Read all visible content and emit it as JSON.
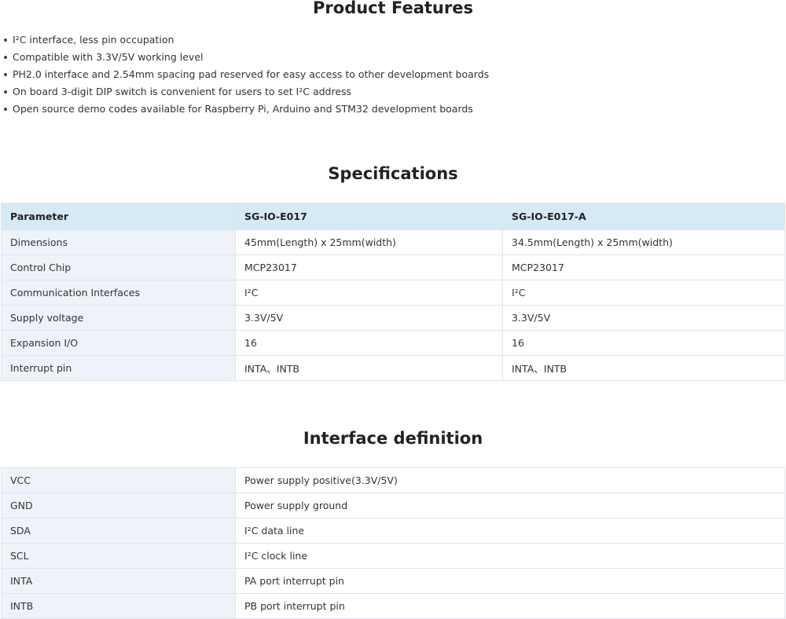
{
  "features": {
    "title": "Product Features",
    "items": [
      "I²C interface, less pin occupation",
      "Compatible with 3.3V/5V working level",
      "PH2.0 interface and 2.54mm spacing pad reserved for easy access to other development boards",
      "On board 3-digit DIP switch is convenient for users to set I²C address",
      "Open source demo codes available for Raspberry Pi, Arduino and STM32 development boards"
    ]
  },
  "specifications": {
    "title": "Specifications",
    "headers": [
      "Parameter",
      "SG-IO-E017",
      "SG-IO-E017-A"
    ],
    "rows": [
      [
        "Dimensions",
        "45mm(Length) x 25mm(width)",
        "34.5mm(Length) x 25mm(width)"
      ],
      [
        "Control Chip",
        "MCP23017",
        "MCP23017"
      ],
      [
        "Communication Interfaces",
        "I²C",
        "I²C"
      ],
      [
        "Supply voltage",
        "3.3V/5V",
        "3.3V/5V"
      ],
      [
        "Expansion I/O",
        "16",
        "16"
      ],
      [
        "Interrupt pin",
        "INTA、INTB",
        "INTA、INTB"
      ]
    ]
  },
  "interface": {
    "title": "Interface definition",
    "rows": [
      [
        "VCC",
        "Power supply positive(3.3V/5V)"
      ],
      [
        "GND",
        "Power supply ground"
      ],
      [
        "SDA",
        "I²C data line"
      ],
      [
        "SCL",
        "I²C clock line"
      ],
      [
        "INTA",
        "PA port interrupt pin"
      ],
      [
        "INTB",
        "PB port interrupt pin"
      ]
    ]
  }
}
